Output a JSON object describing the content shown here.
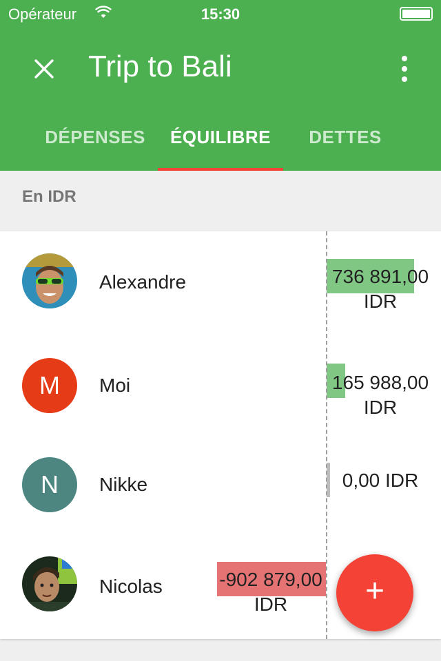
{
  "status_bar": {
    "carrier": "Opérateur",
    "time": "15:30"
  },
  "toolbar": {
    "title": "Trip to Bali",
    "close_icon": "close-icon",
    "menu_icon": "more-vert-icon"
  },
  "tabs": [
    {
      "label": "DÉPENSES",
      "active": false
    },
    {
      "label": "ÉQUILIBRE",
      "active": true
    },
    {
      "label": "DETTES",
      "active": false
    }
  ],
  "subheader": "En IDR",
  "colors": {
    "primary": "#4caf50",
    "accent": "#f44336",
    "positive": "#81c784",
    "negative": "#e57373",
    "zero": "#bdbdbd"
  },
  "balances": [
    {
      "name": "Alexandre",
      "avatar": "photo",
      "amount_text": "736 891,00 IDR",
      "value": 736891
    },
    {
      "name": "Moi",
      "avatar_letter": "M",
      "avatar_color": "#e53b17",
      "amount_text": "165 988,00 IDR",
      "value": 165988
    },
    {
      "name": "Nikke",
      "avatar_letter": "N",
      "avatar_color": "#4d8681",
      "amount_text": "0,00 IDR",
      "value": 0
    },
    {
      "name": "Nicolas",
      "avatar": "photo",
      "amount_text": "-902 879,00 IDR",
      "value": -902879
    }
  ],
  "fab": {
    "label": "+",
    "icon": "add-icon"
  }
}
